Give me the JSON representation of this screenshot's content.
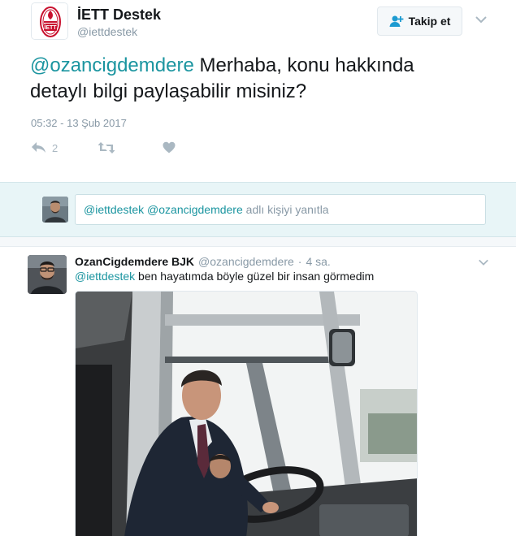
{
  "main_tweet": {
    "display_name": "İETT Destek",
    "handle": "@iettdestek",
    "follow_label": "Takip et",
    "mention": "@ozancigdemdere",
    "text_line1": " Merhaba, konu hakkında",
    "text_line2": "detaylı bilgi paylaşabilir misiniz?",
    "timestamp": "05:32 - 13 Şub 2017",
    "reply_count": "2",
    "avatar_logo_text": "İETT"
  },
  "reply_box": {
    "mention_1": "@iettdestek",
    "mention_2": "@ozancigdemdere",
    "placeholder_suffix": " adlı kişiyi yanıtla"
  },
  "reply_tweet": {
    "display_name": "OzanCigdemdere BJK",
    "handle": "@ozancigdemdere",
    "dot": "·",
    "time_ago": "4 sa.",
    "mention": "@iettdestek",
    "text": " ben hayatımda böyle güzel bir insan görmedim"
  },
  "colors": {
    "link": "#1b95a0",
    "muted": "#8899a6",
    "icon": "#aab8c2",
    "reply_bar_bg": "#e8f5f7",
    "brand_red": "#c8102e"
  },
  "icons": {
    "follow": "add-user-icon",
    "caret": "chevron-down-icon",
    "reply": "reply-icon",
    "retweet": "retweet-icon",
    "like": "heart-icon"
  }
}
